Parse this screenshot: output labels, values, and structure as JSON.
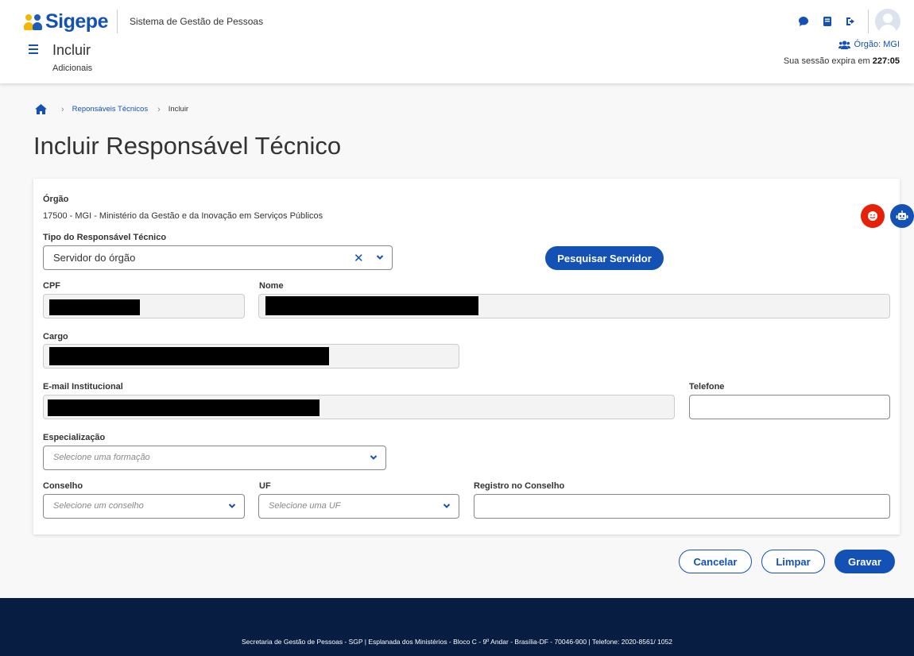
{
  "header": {
    "logo_text": "Sigepe",
    "system_name": "Sistema de Gestão de Pessoas",
    "page_title": "Incluir",
    "page_subtitle": "Adicionais",
    "orgao": "Órgão: MGI",
    "session_prefix": "Sua sessão expira em ",
    "session_time": "227:05",
    "icons": [
      "chat-icon",
      "book-icon",
      "logout-icon",
      "user-avatar"
    ]
  },
  "breadcrumb": {
    "home_icon": "home-icon",
    "link": "Reponsáveis Técnicos",
    "current": "Incluir"
  },
  "title": "Incluir Responsável Técnico",
  "form": {
    "orgao_label": "Órgão",
    "orgao_value": "17500 - MGI - Ministério da Gestão e da Inovação em Serviços Públicos",
    "tipo_label": "Tipo do Responsável Técnico",
    "tipo_value": "Servidor do órgão",
    "pesquisar_label": "Pesquisar Servidor",
    "cpf_label": "CPF",
    "nome_label": "Nome",
    "cargo_label": "Cargo",
    "email_label": "E-mail Institucional",
    "telefone_label": "Telefone",
    "telefone_value": "",
    "especializacao_label": "Especialização",
    "especializacao_placeholder": "Selecione uma formação",
    "conselho_label": "Conselho",
    "conselho_placeholder": "Selecione um conselho",
    "uf_label": "UF",
    "uf_placeholder": "Selecione uma UF",
    "registro_label": "Registro no Conselho",
    "registro_value": ""
  },
  "actions": {
    "cancelar": "Cancelar",
    "limpar": "Limpar",
    "gravar": "Gravar"
  },
  "footer": {
    "text": "Secretaria de Gestão de Pessoas - SGP | Esplanada dos Ministérios - Bloco C - 9º Andar - Brasília-DF - 70046-900 | Telefone: 2020-8561/ 1052"
  },
  "colors": {
    "primary": "#1351b4",
    "footer_bg": "#071d41",
    "danger": "#e52207",
    "logo_yellow": "#f2b705"
  }
}
